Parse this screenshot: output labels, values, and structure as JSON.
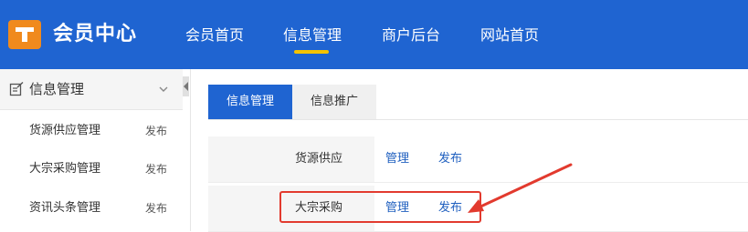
{
  "header": {
    "brand": "会员中心",
    "nav": [
      {
        "label": "会员首页"
      },
      {
        "label": "信息管理",
        "active": true
      },
      {
        "label": "商户后台"
      },
      {
        "label": "网站首页"
      }
    ]
  },
  "sidebar": {
    "section_title": "信息管理",
    "items": [
      {
        "label": "货源供应管理",
        "action": "发布"
      },
      {
        "label": "大宗采购管理",
        "action": "发布"
      },
      {
        "label": "资讯头条管理",
        "action": "发布"
      }
    ]
  },
  "main": {
    "tabs": [
      {
        "label": "信息管理",
        "active": true
      },
      {
        "label": "信息推广"
      }
    ],
    "rows": [
      {
        "name": "货源供应",
        "manage": "管理",
        "publish": "发布"
      },
      {
        "name": "大宗采购",
        "manage": "管理",
        "publish": "发布"
      }
    ]
  },
  "colors": {
    "header_bg": "#1f64d1",
    "accent_underline": "#f5c300",
    "logo_bg": "#f08a1d",
    "link": "#1f5fbf",
    "annotation_red": "#e23a2e"
  },
  "icons": [
    "logo-t-icon",
    "edit-icon",
    "chevron-down-icon",
    "collapse-arrow-icon",
    "annotation-arrow"
  ]
}
